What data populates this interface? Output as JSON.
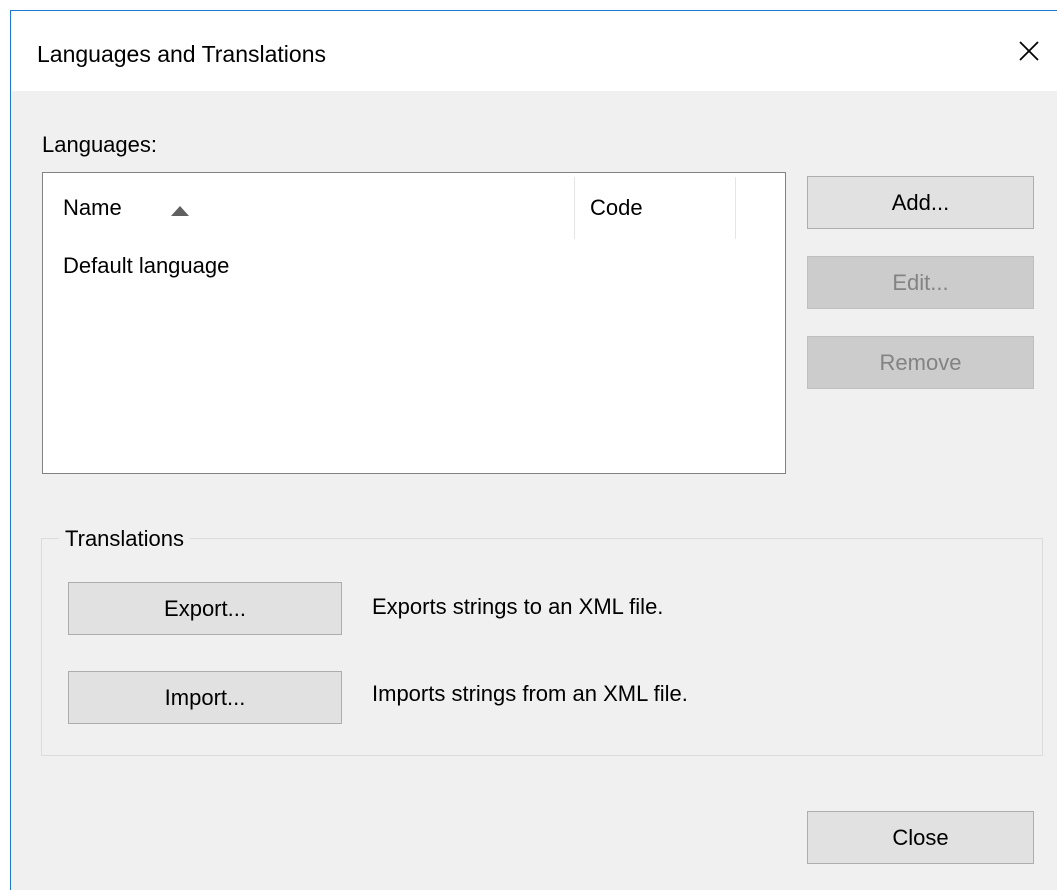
{
  "dialog": {
    "title": "Languages and Translations",
    "languages_label": "Languages:",
    "list": {
      "columns": [
        "Name",
        "Code"
      ],
      "sort": "Name ascending",
      "rows": [
        {
          "name": "Default language",
          "code": ""
        }
      ]
    },
    "buttons": {
      "add": "Add...",
      "edit": "Edit...",
      "remove": "Remove",
      "close": "Close"
    },
    "translations": {
      "group_label": "Translations",
      "export_button": "Export...",
      "export_description": "Exports strings to an XML file.",
      "import_button": "Import...",
      "import_description": "Imports strings from an XML file."
    }
  }
}
